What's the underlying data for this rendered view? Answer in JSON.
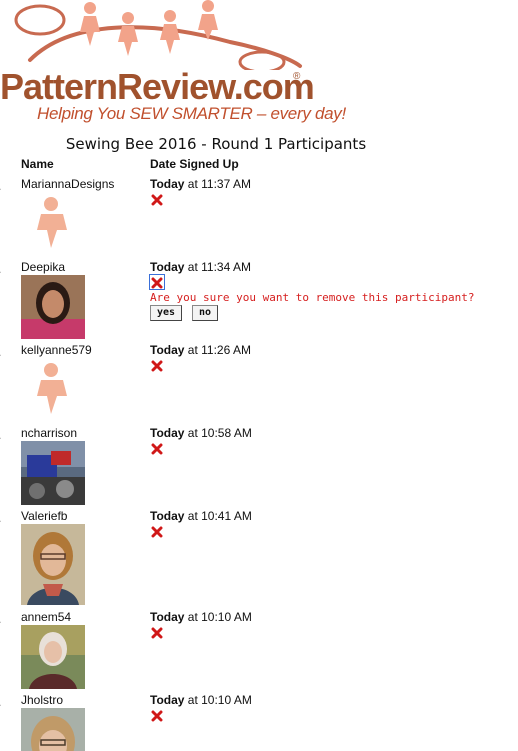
{
  "logo": {
    "brand": "PatternReview.com",
    "registered": "®",
    "tagline": "Helping You SEW SMARTER – every day!"
  },
  "page_title": "Sewing Bee 2016 - Round 1 Participants",
  "columns": {
    "name": "Name",
    "date": "Date Signed Up"
  },
  "colors": {
    "brand": "#a0522d",
    "tagline": "#c1502e",
    "confirm": "#d62020",
    "avatar_placeholder": "#f2b095"
  },
  "participants": [
    {
      "num": ".",
      "name": "MariannaDesigns",
      "day": "Today",
      "time": " at 11:37 AM",
      "avatar": "placeholder-figure-icon"
    },
    {
      "num": ".",
      "name": "Deepika",
      "day": "Today",
      "time": " at 11:34 AM",
      "avatar": "photo",
      "confirm": {
        "text": "Are you sure you want to remove this participant?",
        "yes": "yes",
        "no": "no"
      }
    },
    {
      "num": ".",
      "name": "kellyanne579",
      "day": "Today",
      "time": " at 11:26 AM",
      "avatar": "placeholder-figure-icon"
    },
    {
      "num": ".",
      "name": "ncharrison",
      "day": "Today",
      "time": " at 10:58 AM",
      "avatar": "photo"
    },
    {
      "num": ".",
      "name": "Valeriefb",
      "day": "Today",
      "time": " at 10:41 AM",
      "avatar": "photo"
    },
    {
      "num": ".",
      "name": "annem54",
      "day": "Today",
      "time": " at 10:10 AM",
      "avatar": "photo"
    },
    {
      "num": ".",
      "name": "Jholstro",
      "day": "Today",
      "time": " at 10:10 AM",
      "avatar": "photo"
    }
  ]
}
